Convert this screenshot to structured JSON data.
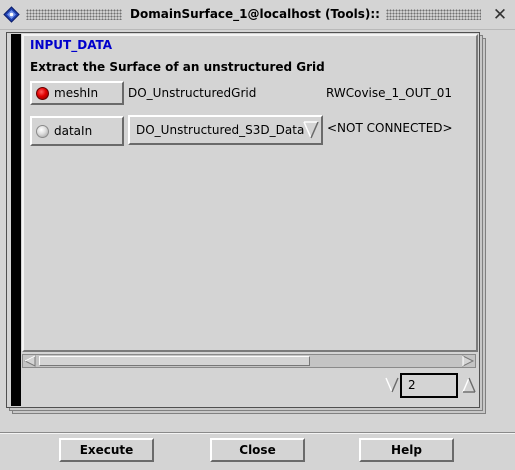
{
  "window": {
    "title": "DomainSurface_1@localhost (Tools)::",
    "close_glyph": "✕"
  },
  "module": {
    "section_title": "INPUT_DATA",
    "description": "Extract the Surface of an unstructured Grid",
    "ports": [
      {
        "label": "meshIn",
        "type": "DO_UnstructuredGrid",
        "connection": "RWCovise_1_OUT_01",
        "status_color": "#e00000"
      },
      {
        "label": "dataIn",
        "type": "DO_Unstructured_S3D_Data",
        "connection": "<NOT CONNECTED>",
        "status_color": "#dcdcdc"
      }
    ]
  },
  "stepper": {
    "value": "2"
  },
  "footer": {
    "execute_label": "Execute",
    "close_label": "Close",
    "help_label": "Help"
  },
  "icons": {
    "app": "covise-app-icon",
    "dropdown": "triangle-down-icon",
    "scroll_left": "triangle-left-icon",
    "scroll_right": "triangle-right-icon"
  }
}
